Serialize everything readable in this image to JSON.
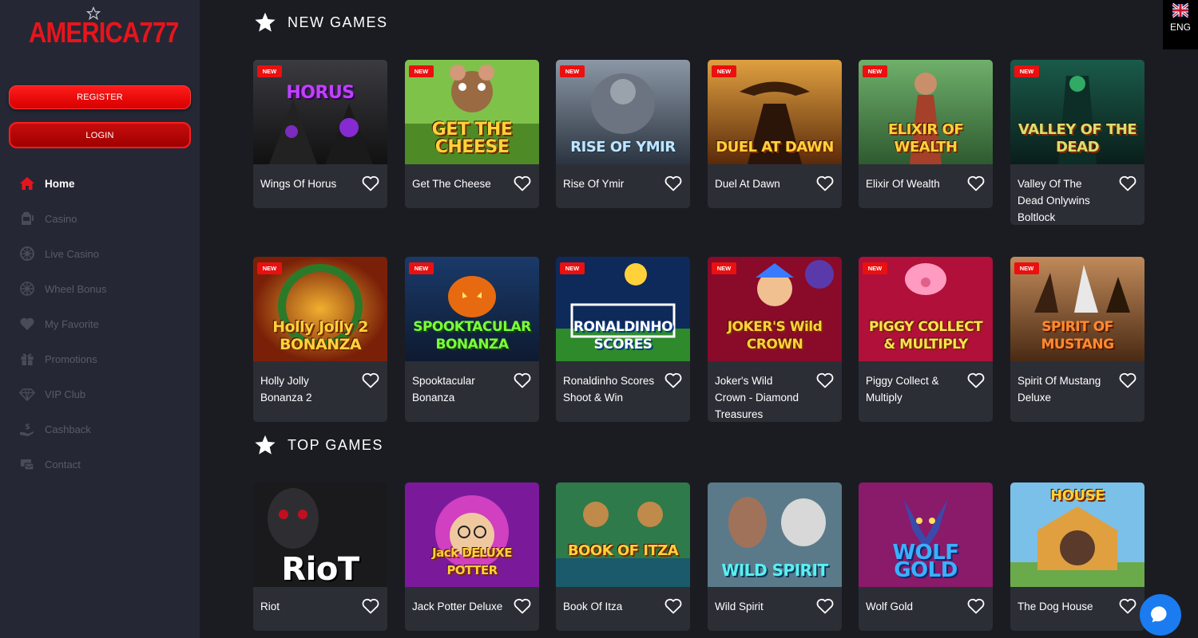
{
  "brand": {
    "logo_text": "AMERICA777"
  },
  "auth": {
    "register_label": "REGISTER",
    "login_label": "LOGIN"
  },
  "nav": [
    {
      "label": "Home",
      "icon": "home-icon",
      "active": true
    },
    {
      "label": "Casino",
      "icon": "slot-machine-icon"
    },
    {
      "label": "Live Casino",
      "icon": "roulette-icon"
    },
    {
      "label": "Wheel Bonus",
      "icon": "wheel-icon"
    },
    {
      "label": "My Favorite",
      "icon": "heart-icon"
    },
    {
      "label": "Promotions",
      "icon": "gift-icon"
    },
    {
      "label": "VIP Club",
      "icon": "diamond-icon"
    },
    {
      "label": "Cashback",
      "icon": "cashback-icon"
    },
    {
      "label": "Contact",
      "icon": "contact-icon"
    }
  ],
  "language": {
    "label": "ENG",
    "flag": "uk-flag-icon"
  },
  "sections": {
    "new_games": {
      "title": "NEW GAMES"
    },
    "top_games": {
      "title": "TOP GAMES"
    }
  },
  "new_badge": "NEW",
  "new_games": [
    {
      "name": "Wings Of Horus",
      "thumb_text": "HORUS"
    },
    {
      "name": "Get The Cheese",
      "thumb_text": "GET THE CHEESE"
    },
    {
      "name": "Rise Of Ymir",
      "thumb_text": "RISE OF YMIR"
    },
    {
      "name": "Duel At Dawn",
      "thumb_text": "DUEL AT DAWN"
    },
    {
      "name": "Elixir Of Wealth",
      "thumb_text": "ELIXIR OF WEALTH"
    },
    {
      "name": "Valley Of The Dead Onlywins Boltlock",
      "thumb_text": "VALLEY OF THE DEAD"
    },
    {
      "name": "Holly Jolly Bonanza 2",
      "thumb_text": "Holly Jolly 2 BONANZA"
    },
    {
      "name": "Spooktacular Bonanza",
      "thumb_text": "SPOOKTACULAR BONANZA"
    },
    {
      "name": "Ronaldinho Scores Shoot & Win",
      "thumb_text": "RONALDINHO SCORES"
    },
    {
      "name": "Joker's Wild Crown - Diamond Treasures",
      "thumb_text": "JOKER'S Wild CROWN"
    },
    {
      "name": "Piggy Collect & Multiply",
      "thumb_text": "PIGGY COLLECT & MULTIPLY"
    },
    {
      "name": "Spirit Of Mustang Deluxe",
      "thumb_text": "SPIRIT OF MUSTANG"
    }
  ],
  "top_games": [
    {
      "name": "Riot",
      "thumb_text": "RioT"
    },
    {
      "name": "Jack Potter Deluxe",
      "thumb_text": "Jack DELUXE POTTER"
    },
    {
      "name": "Book Of Itza",
      "thumb_text": "BOOK OF ITZA"
    },
    {
      "name": "Wild Spirit",
      "thumb_text": "WILD SPIRIT"
    },
    {
      "name": "Wolf Gold",
      "thumb_text": "WOLF GOLD"
    },
    {
      "name": "The Dog House",
      "thumb_text": "HOUSE"
    }
  ],
  "colors": {
    "accent": "#e8141c",
    "sidebar": "#252834",
    "background": "#1b1c22",
    "card": "#2c2e36",
    "chat": "#1a7cf0"
  }
}
